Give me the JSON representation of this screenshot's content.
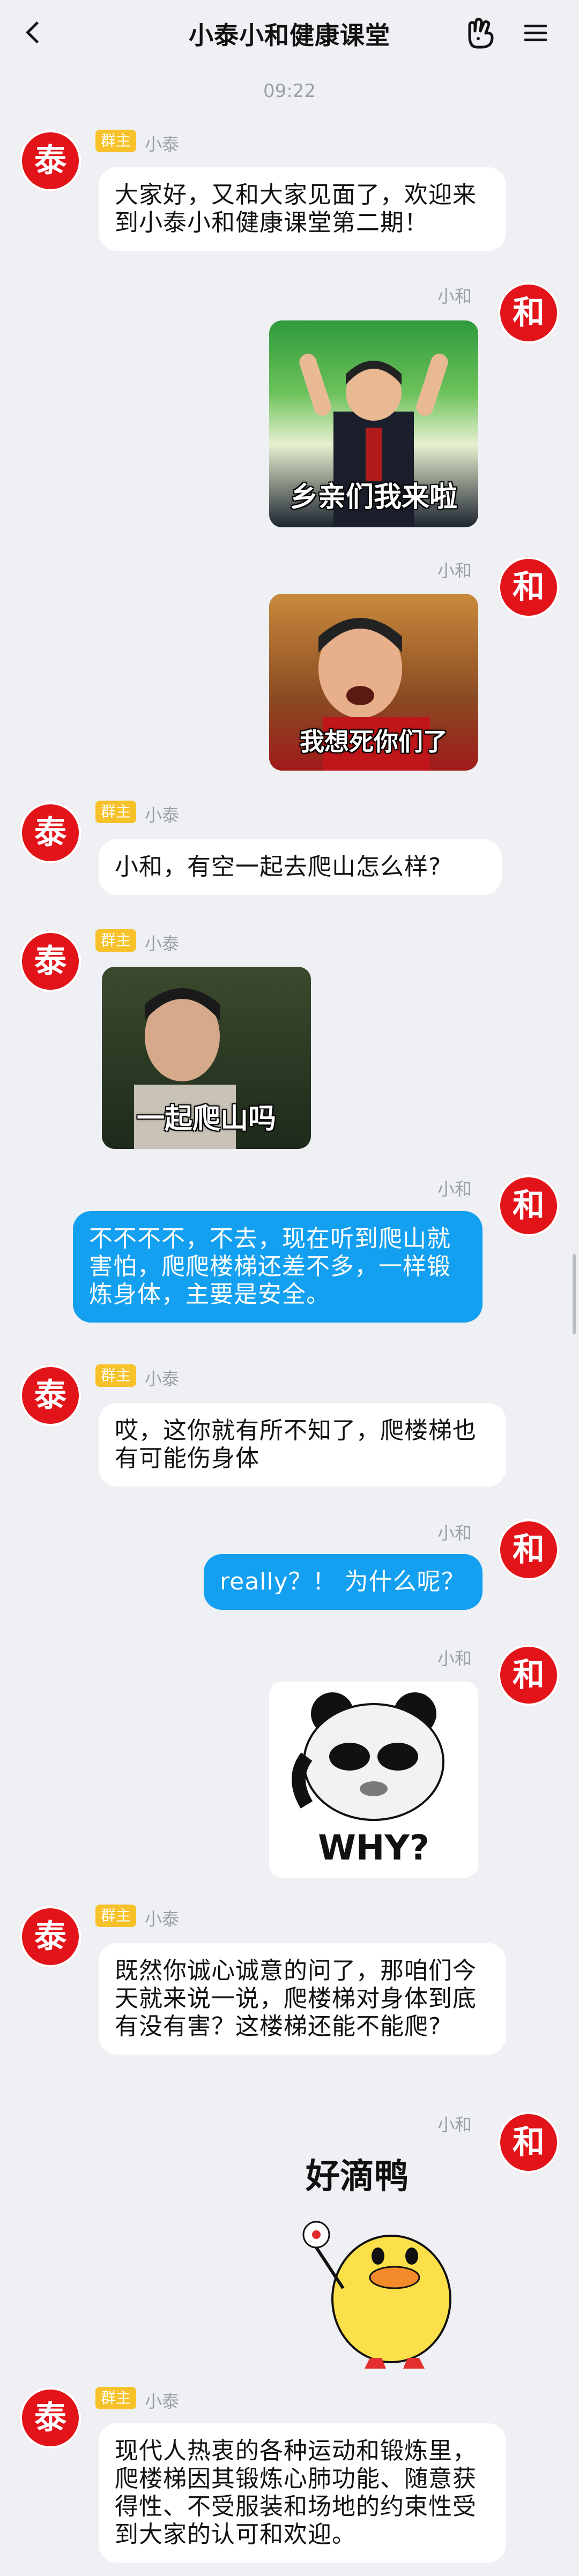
{
  "header": {
    "title": "小泰小和健康课堂"
  },
  "time": "09:22",
  "badge": "群主",
  "avatar_char_tai": "泰",
  "avatar_char_he": "和",
  "names": {
    "tai": "小泰",
    "he": "小和"
  },
  "messages": {
    "m1": "大家好，又和大家见面了，欢迎来到小泰小和健康课堂第二期！",
    "m2_caption": "乡亲们我来啦",
    "m3_caption": "我想死你们了",
    "m4": "小和，有空一起去爬山怎么样?",
    "m5_caption": "一起爬山吗",
    "m6": "不不不不，不去，现在听到爬山就害怕，爬爬楼梯还差不多，一样锻炼身体，主要是安全。",
    "m7": "哎，这你就有所不知了，爬楼梯也有可能伤身体",
    "m8": "really？！ 为什么呢？",
    "m9_caption": "WHY?",
    "m10": "既然你诚心诚意的问了，那咱们今天就来说一说，爬楼梯对身体到底有没有害？这楼梯还能不能爬?",
    "m11_caption": "好滴鸭",
    "m12": "现代人热衷的各种运动和锻炼里，爬楼梯因其锻炼心肺功能、随意获得性、不受服装和场地的约束性受到大家的认可和欢迎。"
  },
  "colors": {
    "brand_red": "#e21319",
    "outgoing": "#14a0f0",
    "badge": "#f7c12a"
  }
}
